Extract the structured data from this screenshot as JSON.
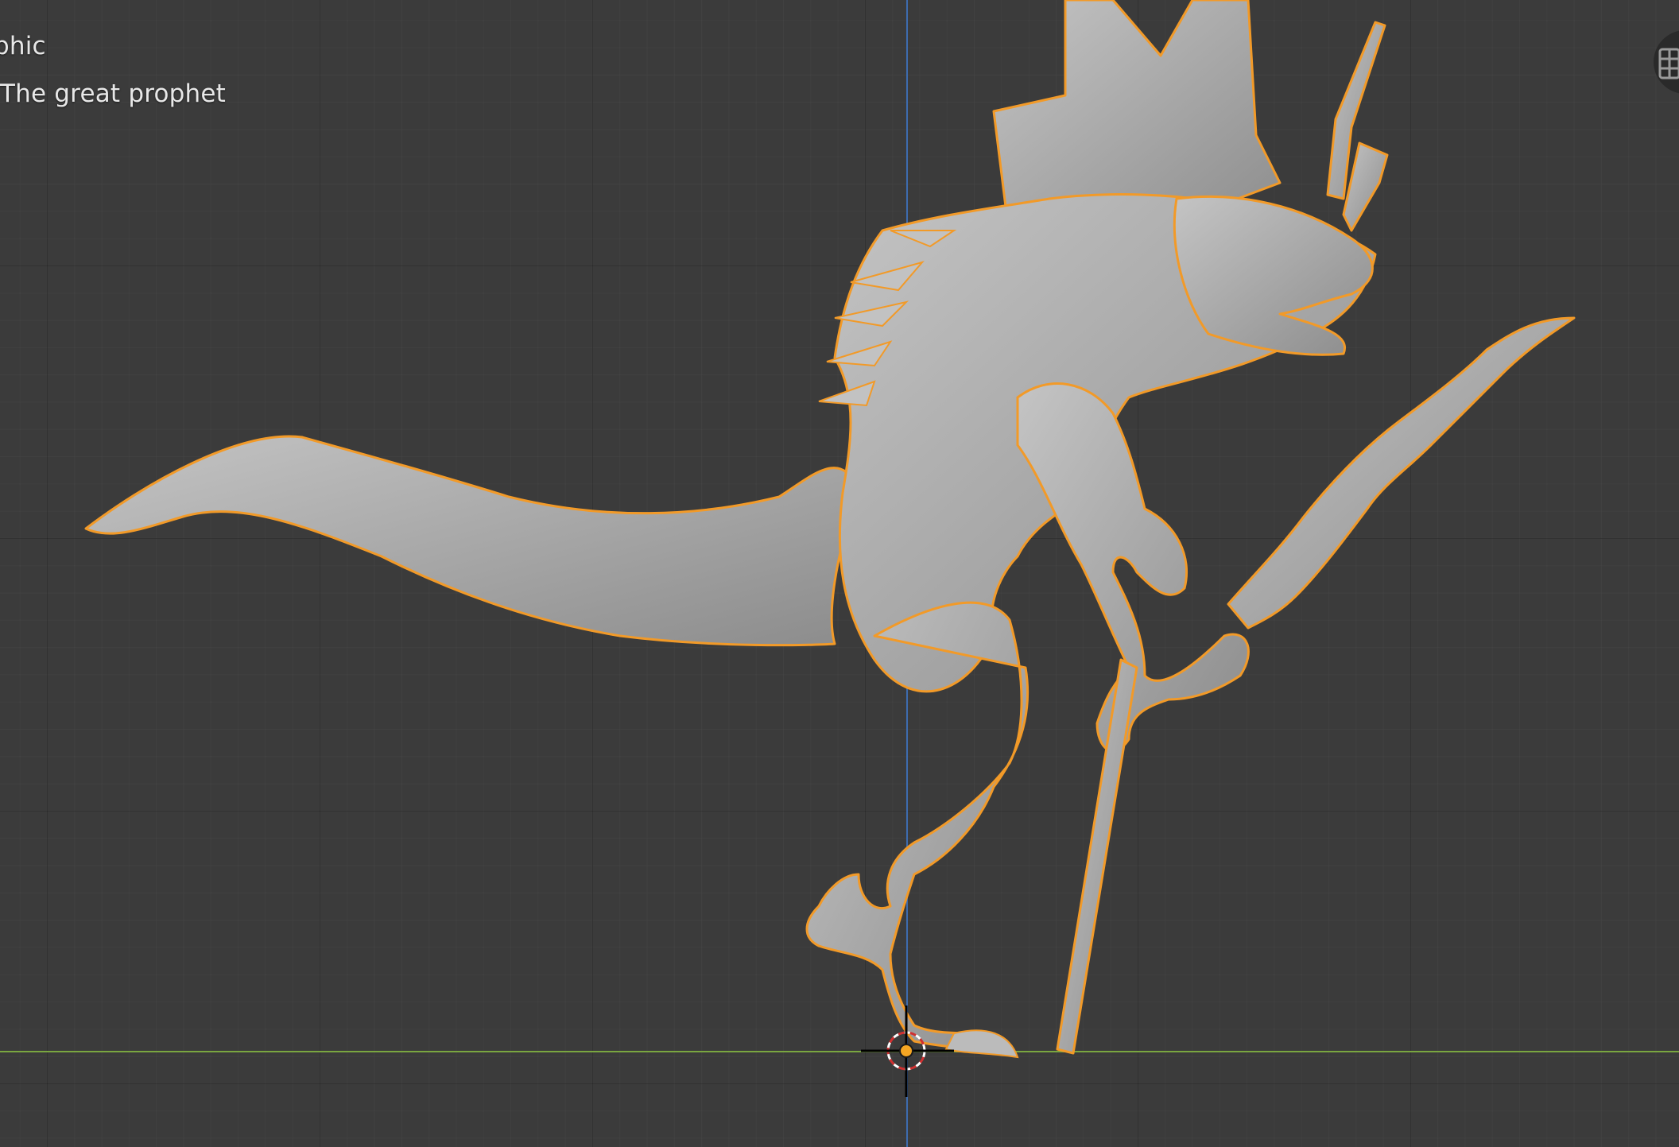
{
  "viewport": {
    "view_mode_label": "phic",
    "object_label": "The great prophet"
  },
  "colors": {
    "background": "#3b3b3b",
    "axis_x": "#7aa640",
    "axis_y": "#3d6fb5",
    "selection_outline": "#f29a28",
    "model": "#a9a9a9"
  },
  "icons": {
    "cursor": "3d-cursor-icon",
    "origin": "object-origin-icon",
    "gizmo": "grid-view-icon"
  }
}
